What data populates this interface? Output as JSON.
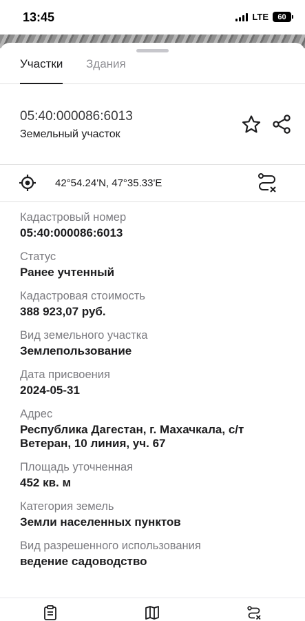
{
  "status_bar": {
    "time": "13:45",
    "network": "LTE",
    "battery": "60"
  },
  "tabs": [
    {
      "label": "Участки",
      "active": true
    },
    {
      "label": "Здания",
      "active": false
    }
  ],
  "parcel": {
    "cadastral_number": "05:40:000086:6013",
    "type": "Земельный участок"
  },
  "coordinates": "42°54.24'N, 47°35.33'E",
  "fields": [
    {
      "label": "Кадастровый номер",
      "value": "05:40:000086:6013"
    },
    {
      "label": "Статус",
      "value": "Ранее учтенный"
    },
    {
      "label": "Кадастровая стоимость",
      "value": "388 923,07 руб."
    },
    {
      "label": "Вид земельного участка",
      "value": "Землепользование"
    },
    {
      "label": "Дата присвоения",
      "value": "2024-05-31"
    },
    {
      "label": "Адрес",
      "value": "Республика Дагестан, г. Махачкала, с/т Ветеран, 10 линия, уч. 67"
    },
    {
      "label": "Площадь уточненная",
      "value": "452 кв. м"
    },
    {
      "label": "Категория земель",
      "value": "Земли населенных пунктов"
    },
    {
      "label": "Вид разрешенного использования",
      "value": "ведение садоводство"
    }
  ],
  "icons": {
    "favorite": "star-icon",
    "share": "share-icon",
    "locate": "location-target-icon",
    "route": "route-cancel-icon",
    "bottom": [
      "clipboard-list-icon",
      "map-icon",
      "route-cancel-icon"
    ]
  }
}
